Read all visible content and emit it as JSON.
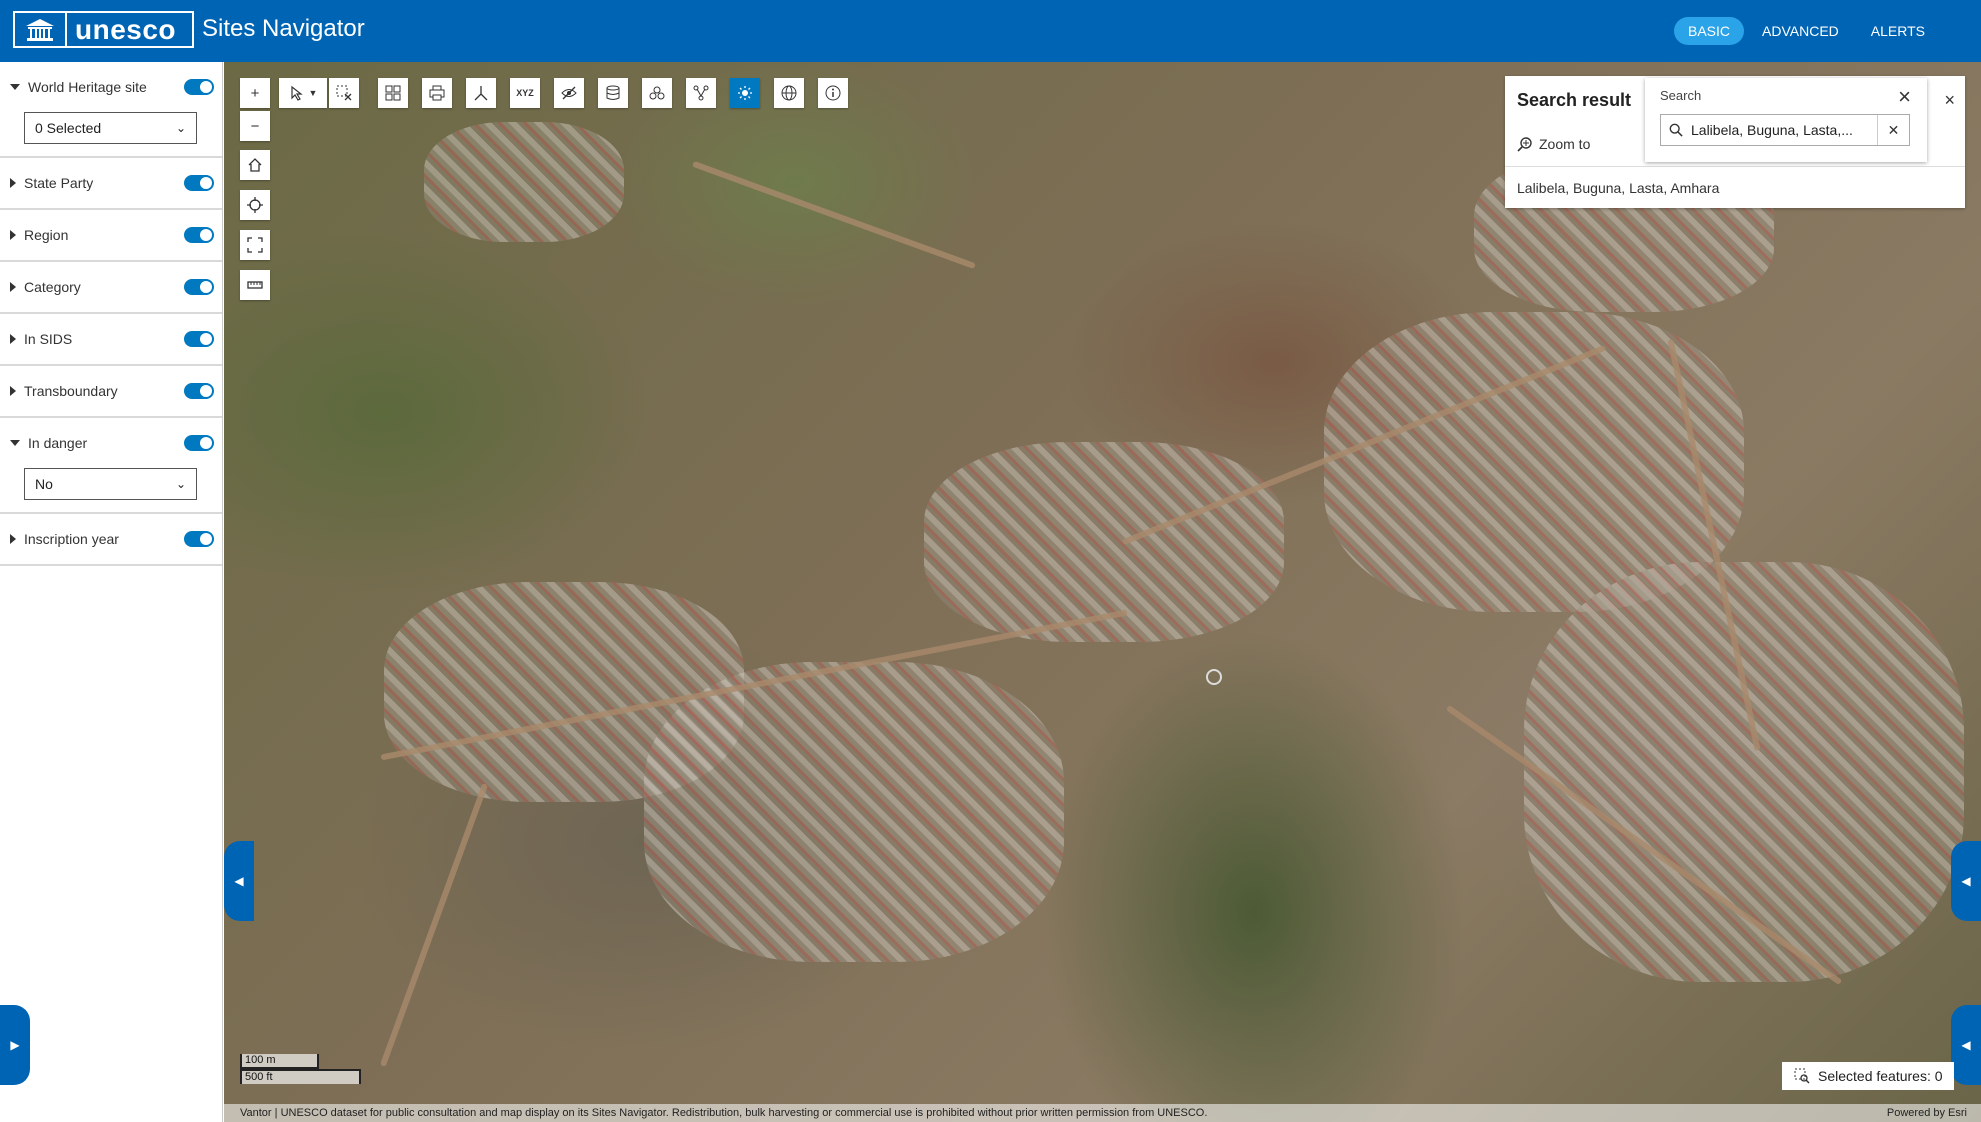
{
  "header": {
    "logo_text": "unesco",
    "app_title": "Sites Navigator",
    "nav": [
      {
        "label": "BASIC",
        "active": true
      },
      {
        "label": "ADVANCED",
        "active": false
      },
      {
        "label": "ALERTS",
        "active": false
      }
    ]
  },
  "sidebar": {
    "filters": [
      {
        "label": "World Heritage site",
        "expanded": true,
        "enabled": true,
        "select": "0 Selected"
      },
      {
        "label": "State Party",
        "expanded": false,
        "enabled": true
      },
      {
        "label": "Region",
        "expanded": false,
        "enabled": true
      },
      {
        "label": "Category",
        "expanded": false,
        "enabled": true
      },
      {
        "label": "In SIDS",
        "expanded": false,
        "enabled": true
      },
      {
        "label": "Transboundary",
        "expanded": false,
        "enabled": true
      },
      {
        "label": "In danger",
        "expanded": true,
        "enabled": true,
        "select": "No"
      },
      {
        "label": "Inscription year",
        "expanded": false,
        "enabled": true
      }
    ]
  },
  "search_result": {
    "title": "Search result",
    "zoom_to": "Zoom to",
    "item": "Lalibela, Buguna, Lasta, Amhara"
  },
  "search": {
    "label": "Search",
    "value": "Lalibela, Buguna, Lasta,..."
  },
  "scale": {
    "metric": "100 m",
    "imperial": "500 ft"
  },
  "selected_features": "Selected features: 0",
  "attribution": {
    "text": "Vantor | UNESCO dataset for public consultation and map display on its Sites Navigator. Redistribution, bulk harvesting or commercial use is prohibited without prior written permission from UNESCO.",
    "powered_by": "Powered by Esri"
  },
  "colors": {
    "brand": "#0064b4",
    "accent": "#0079c1",
    "nav_active": "#2aa3e8"
  }
}
